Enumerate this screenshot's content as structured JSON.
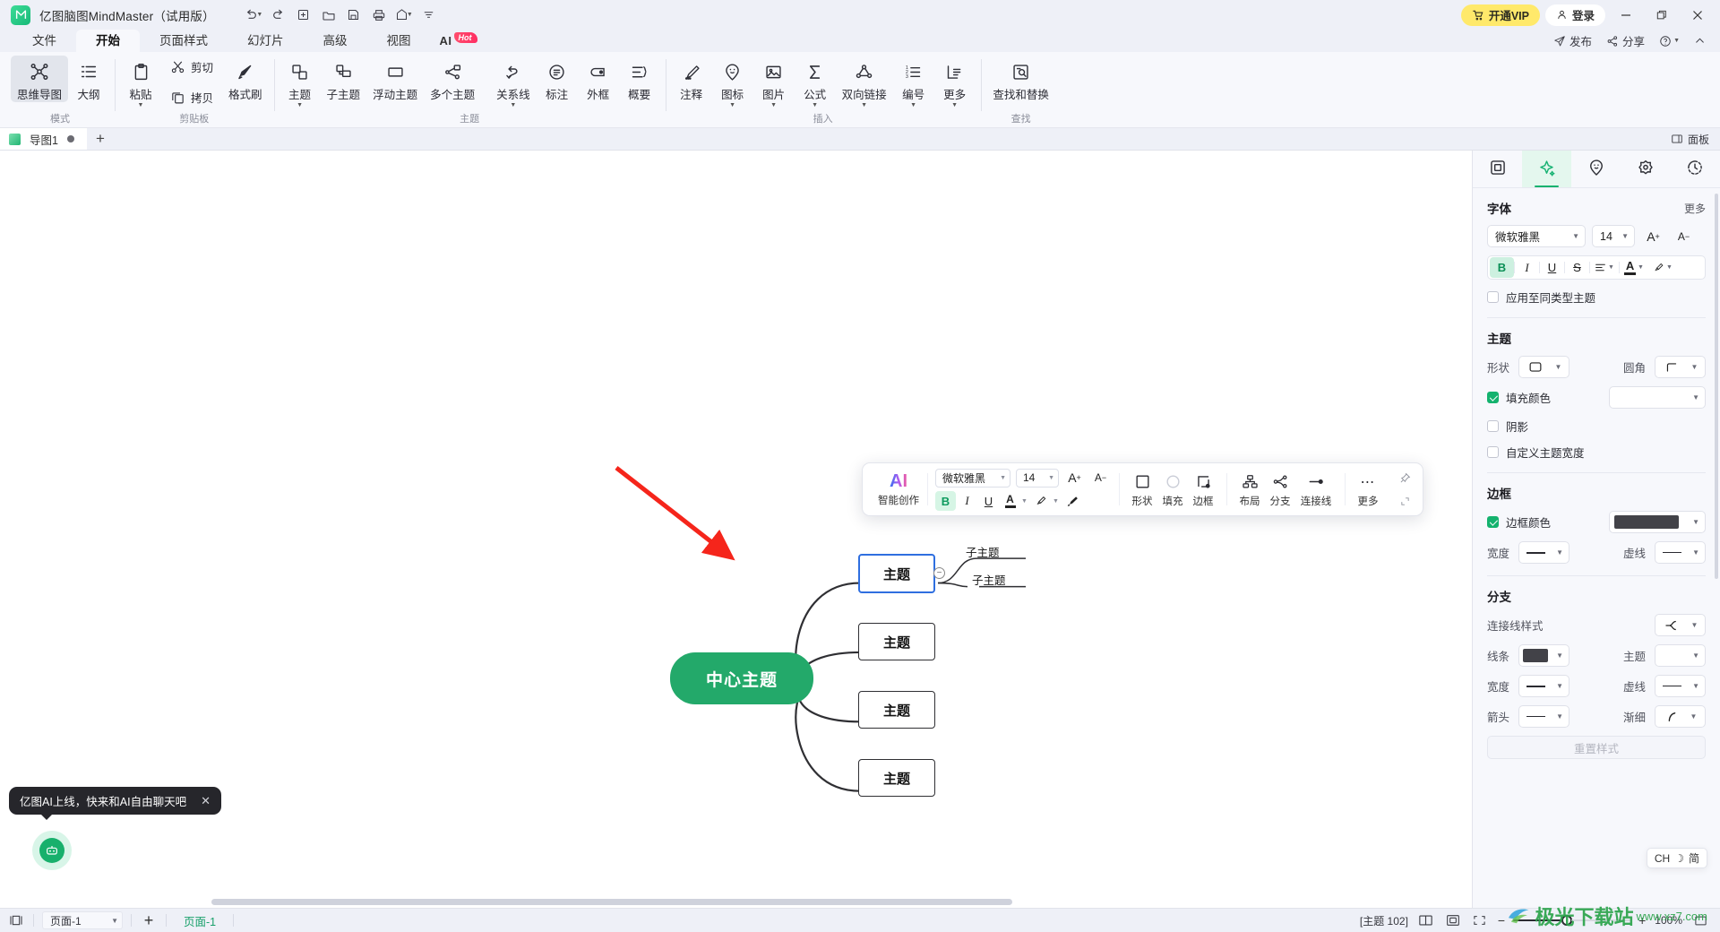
{
  "titlebar": {
    "app_title": "亿图脑图MindMaster（试用版）",
    "logo_glyph": "M",
    "quick_access": [
      {
        "name": "undo",
        "glyph": "↺",
        "caret": true
      },
      {
        "name": "redo",
        "glyph": "↻",
        "caret": false
      },
      {
        "name": "new",
        "glyph": "⊞",
        "caret": false
      },
      {
        "name": "open",
        "glyph": "🗁",
        "caret": false
      },
      {
        "name": "save",
        "glyph": "💾",
        "caret": false
      },
      {
        "name": "print",
        "glyph": "🖶",
        "caret": false
      },
      {
        "name": "export",
        "glyph": "↗",
        "caret": true
      },
      {
        "name": "customize",
        "glyph": "⌄",
        "caret": false
      }
    ],
    "vip_label": "开通VIP",
    "login_label": "登录",
    "minimize": "—",
    "maximize": "🗗",
    "close": "✕"
  },
  "menubar": {
    "items": [
      {
        "label": "文件",
        "active": false
      },
      {
        "label": "开始",
        "active": true
      },
      {
        "label": "页面样式",
        "active": false
      },
      {
        "label": "幻灯片",
        "active": false
      },
      {
        "label": "高级",
        "active": false
      },
      {
        "label": "视图",
        "active": false
      }
    ],
    "ai_label": "AI",
    "ai_badge": "Hot",
    "right_actions": [
      {
        "label": "发布",
        "icon": "send-icon"
      },
      {
        "label": "分享",
        "icon": "share-icon"
      },
      {
        "label": "",
        "icon": "help-icon"
      },
      {
        "label": "",
        "icon": "collapse-ribbon-icon"
      }
    ]
  },
  "ribbon": {
    "groups": [
      {
        "name": "模式",
        "items": [
          {
            "label": "思维导图",
            "icon": "mindmap-icon",
            "dropdown": false,
            "selected": true
          },
          {
            "label": "大纲",
            "icon": "outline-icon",
            "dropdown": false,
            "selected": false
          }
        ]
      },
      {
        "name": "剪贴板",
        "items": [
          {
            "label": "粘贴",
            "icon": "paste-icon",
            "dropdown": true,
            "selected": false
          },
          {
            "label": "剪切",
            "icon": "cut-icon",
            "dropdown": false,
            "selected": false,
            "horizontal": true
          },
          {
            "label": "拷贝",
            "icon": "copy-icon",
            "dropdown": false,
            "selected": false,
            "horizontal": true
          },
          {
            "label": "格式刷",
            "icon": "format-painter-icon",
            "dropdown": false,
            "selected": false
          }
        ]
      },
      {
        "name": "主题",
        "items": [
          {
            "label": "主题",
            "icon": "topic-icon",
            "dropdown": true,
            "selected": false
          },
          {
            "label": "子主题",
            "icon": "subtopic-icon",
            "dropdown": false,
            "selected": false
          },
          {
            "label": "浮动主题",
            "icon": "floating-topic-icon",
            "dropdown": false,
            "selected": false
          },
          {
            "label": "多个主题",
            "icon": "multi-topic-icon",
            "dropdown": false,
            "selected": false
          },
          {
            "label": "关系线",
            "icon": "relation-line-icon",
            "dropdown": true,
            "selected": false
          },
          {
            "label": "标注",
            "icon": "callout-icon",
            "dropdown": false,
            "selected": false
          },
          {
            "label": "外框",
            "icon": "boundary-icon",
            "dropdown": false,
            "selected": false
          },
          {
            "label": "概要",
            "icon": "summary-icon",
            "dropdown": false,
            "selected": false
          }
        ]
      },
      {
        "name": "插入",
        "items": [
          {
            "label": "注释",
            "icon": "note-icon",
            "dropdown": false,
            "selected": false
          },
          {
            "label": "图标",
            "icon": "sticker-icon",
            "dropdown": true,
            "selected": false
          },
          {
            "label": "图片",
            "icon": "image-icon",
            "dropdown": true,
            "selected": false
          },
          {
            "label": "公式",
            "icon": "formula-icon",
            "dropdown": true,
            "selected": false
          },
          {
            "label": "双向链接",
            "icon": "bidirectional-link-icon",
            "dropdown": true,
            "selected": false
          },
          {
            "label": "编号",
            "icon": "numbering-icon",
            "dropdown": true,
            "selected": false
          },
          {
            "label": "更多",
            "icon": "more-icon",
            "dropdown": true,
            "selected": false
          }
        ]
      },
      {
        "name": "查找",
        "items": [
          {
            "label": "查找和替换",
            "icon": "find-replace-icon",
            "dropdown": false,
            "selected": false
          }
        ]
      }
    ]
  },
  "tabstrip": {
    "doc_tab": "导图1",
    "add_label": "+",
    "panel_toggle": "面板"
  },
  "canvas": {
    "central_topic": "中心主题",
    "nodes": [
      {
        "label": "主题",
        "selected": true
      },
      {
        "label": "主题",
        "selected": false
      },
      {
        "label": "主题",
        "selected": false
      },
      {
        "label": "主题",
        "selected": false
      }
    ],
    "subtopics": [
      "子主题",
      "子主题"
    ],
    "collapse_glyph": "−"
  },
  "float_toolbar": {
    "ai_label": "AI",
    "ai_sub": "智能创作",
    "font_family": "微软雅黑",
    "font_size": "14",
    "increase_font": "A",
    "decrease_font": "A",
    "bold": "B",
    "italic": "I",
    "underline": "U",
    "font_color": "A",
    "highlight": "✎",
    "clear_format": "⌫",
    "tools": [
      {
        "label": "形状",
        "icon": "shape-icon"
      },
      {
        "label": "填充",
        "icon": "fill-icon"
      },
      {
        "label": "边框",
        "icon": "border-icon"
      }
    ],
    "tools2": [
      {
        "label": "布局",
        "icon": "layout-icon"
      },
      {
        "label": "分支",
        "icon": "branch-icon"
      },
      {
        "label": "连接线",
        "icon": "connector-icon"
      }
    ],
    "more_label": "更多",
    "more_glyph": "⋯",
    "pin_icon": "pin-icon",
    "resize_icon": "resize-icon"
  },
  "right_panel": {
    "tabs": [
      {
        "name": "page-tab",
        "icon": "page-icon",
        "active": false
      },
      {
        "name": "style-tab",
        "icon": "sparkle-icon",
        "active": true
      },
      {
        "name": "sticker-tab",
        "icon": "sticker-face-icon",
        "active": false
      },
      {
        "name": "shape-tab",
        "icon": "flower-icon",
        "active": false
      },
      {
        "name": "history-tab",
        "icon": "history-clock-icon",
        "active": false
      }
    ],
    "font": {
      "title": "字体",
      "more": "更多",
      "family": "微软雅黑",
      "size": "14",
      "increase": "A",
      "decrease": "A",
      "bold": "B",
      "italic": "I",
      "underline": "U",
      "strike": "S",
      "align": "≡",
      "color": "A",
      "highlight": "✎",
      "apply_same_type": "应用至同类型主题",
      "apply_same_type_checked": false
    },
    "topic": {
      "title": "主题",
      "shape_label": "形状",
      "corner_label": "圆角",
      "fill_color_label": "填充颜色",
      "fill_color_checked": true,
      "fill_color_value": "#ffffff",
      "shadow_label": "阴影",
      "shadow_checked": false,
      "custom_width_label": "自定义主题宽度",
      "custom_width_checked": false
    },
    "border": {
      "title": "边框",
      "color_label": "边框颜色",
      "color_checked": true,
      "color_value": "#424248",
      "width_label": "宽度",
      "dash_label": "虚线"
    },
    "branch": {
      "title": "分支",
      "connector_style_label": "连接线样式",
      "line_label": "线条",
      "line_color": "#424248",
      "topic_label": "主题",
      "width_label": "宽度",
      "dash_label": "虚线",
      "arrow_label": "箭头",
      "taper_label": "渐细",
      "reset_label": "重置样式"
    }
  },
  "ai_tip": {
    "text": "亿图AI上线，快来和AI自由聊天吧",
    "close": "✕"
  },
  "statusbar": {
    "layout_icon": "panel-layout-icon",
    "page_select": "页面-1",
    "add_page": "+",
    "page_tab": "页面-1",
    "topic_count": "[主题 102]",
    "view_icons": [
      "two-page-icon",
      "fit-page-icon",
      "fullscreen-icon"
    ],
    "zoom_minus": "−",
    "zoom_plus": "+",
    "zoom_value": "100%",
    "fit_icon": "fit-screen-icon"
  },
  "ime": {
    "lang": "CH",
    "mode": "简",
    "moon": "☽"
  },
  "watermark": {
    "main": "极光下载站",
    "url": "www.xz7.com"
  }
}
